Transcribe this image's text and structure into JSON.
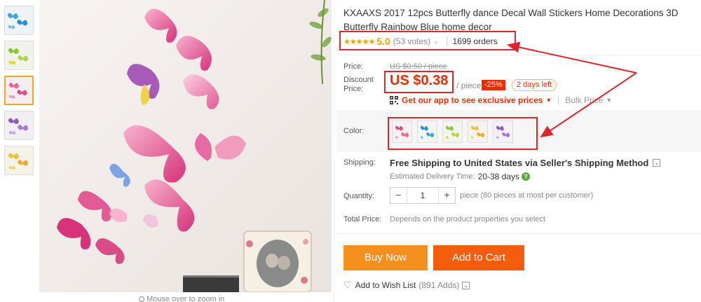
{
  "product": {
    "title": "KXAAXS 2017 12pcs Butterfly dance Decal Wall Stickers Home Decorations 3D Butterfly Rainbow Blue home decor",
    "stars": "★★★★★",
    "rating": "5.0",
    "votes": "(53 votes)",
    "orders": "1699 orders",
    "rating_value": 5.0
  },
  "gallery": {
    "thumbnail_count": 5,
    "active_index": 2,
    "zoom_hint": "Mouse over to zoom in"
  },
  "price": {
    "price_label": "Price:",
    "original": "US $0.50 / piece",
    "discount_label_1": "Discount",
    "discount_label_2": "Price:",
    "current": "US $0.38",
    "per": "/ piece",
    "discount": "-25%",
    "days_left": "2 days left",
    "app_promo": "Get our app to see exclusive prices",
    "bulk": "Bulk Price"
  },
  "color": {
    "label": "Color:",
    "options": [
      "pink",
      "blue",
      "green",
      "yellow",
      "purple"
    ]
  },
  "shipping": {
    "label": "Shipping:",
    "method": "Free Shipping to United States via Seller's Shipping Method",
    "delivery_label": "Estimated Delivery Time:",
    "delivery_days": "20-38 days"
  },
  "quantity": {
    "label": "Quantity:",
    "minus": "−",
    "value": "1",
    "plus": "+",
    "note": "piece (80 pieces at most per customer)"
  },
  "total": {
    "label": "Total Price:",
    "note": "Depends on the product properties you select"
  },
  "actions": {
    "buy_now": "Buy Now",
    "add_to_cart": "Add to Cart",
    "wishlist": "Add to Wish List",
    "wishlist_count": "(891 Adds)"
  },
  "colors": {
    "accent_red": "#e62e04",
    "buy_orange": "#f58f1e",
    "cart_orange": "#f35d0c",
    "star_gold": "#f59d00",
    "annotation_red": "#d9272e"
  }
}
